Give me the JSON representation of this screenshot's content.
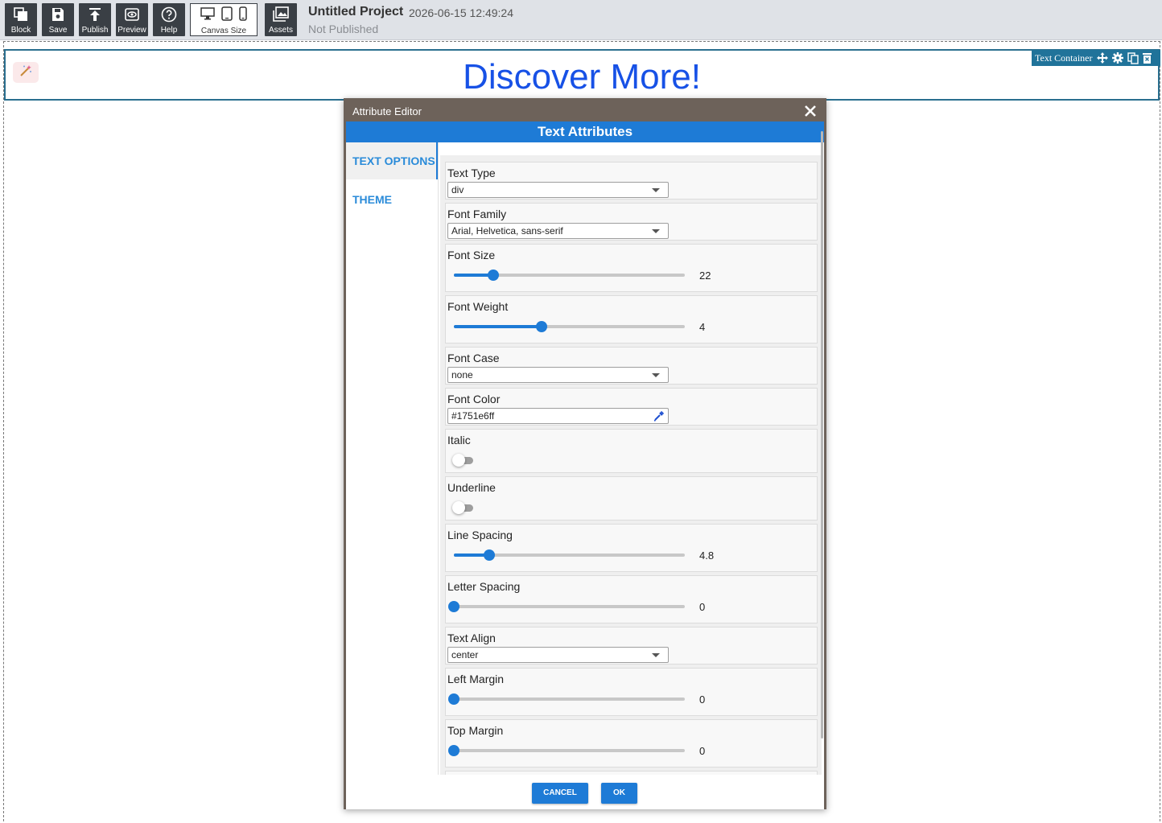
{
  "toolbar": {
    "buttons": [
      {
        "label": "Block",
        "icon": "copy-stack-icon"
      },
      {
        "label": "Save",
        "icon": "save-disk-icon"
      },
      {
        "label": "Publish",
        "icon": "upload-icon"
      },
      {
        "label": "Preview",
        "icon": "eye-icon"
      },
      {
        "label": "Help",
        "icon": "help-circle-icon"
      }
    ],
    "canvas_size_label": "Canvas Size",
    "assets_label": "Assets"
  },
  "project": {
    "title": "Untitled Project",
    "timestamp": "2026-06-15 12:49:24",
    "status": "Not Published"
  },
  "canvas": {
    "heading": "Discover More!",
    "heading_color": "#1751e6",
    "container_label": "Text Container"
  },
  "modal": {
    "title": "Attribute Editor",
    "subtitle": "Text Attributes",
    "tabs": [
      "TEXT OPTIONS",
      "THEME"
    ],
    "cancel_label": "CANCEL",
    "ok_label": "OK",
    "fields": {
      "text_type": {
        "label": "Text Type",
        "value": "div"
      },
      "font_family": {
        "label": "Font Family",
        "value": "Arial, Helvetica, sans-serif"
      },
      "font_size": {
        "label": "Font Size",
        "value": "22",
        "fraction": 0.17
      },
      "font_weight": {
        "label": "Font Weight",
        "value": "4",
        "fraction": 0.38
      },
      "font_case": {
        "label": "Font Case",
        "value": "none"
      },
      "font_color": {
        "label": "Font Color",
        "value": "#1751e6ff"
      },
      "italic": {
        "label": "Italic",
        "on": false
      },
      "underline": {
        "label": "Underline",
        "on": false
      },
      "line_spacing": {
        "label": "Line Spacing",
        "value": "4.8",
        "fraction": 0.155
      },
      "letter_spacing": {
        "label": "Letter Spacing",
        "value": "0",
        "fraction": 0
      },
      "text_align": {
        "label": "Text Align",
        "value": "center"
      },
      "left_margin": {
        "label": "Left Margin",
        "value": "0",
        "fraction": 0
      },
      "top_margin": {
        "label": "Top Margin",
        "value": "0",
        "fraction": 0
      }
    }
  },
  "colors": {
    "accent": "#1e7bd6",
    "toolbar_button": "#3a3f45",
    "modal_header": "#6d625a",
    "container_bar": "#20739a"
  }
}
